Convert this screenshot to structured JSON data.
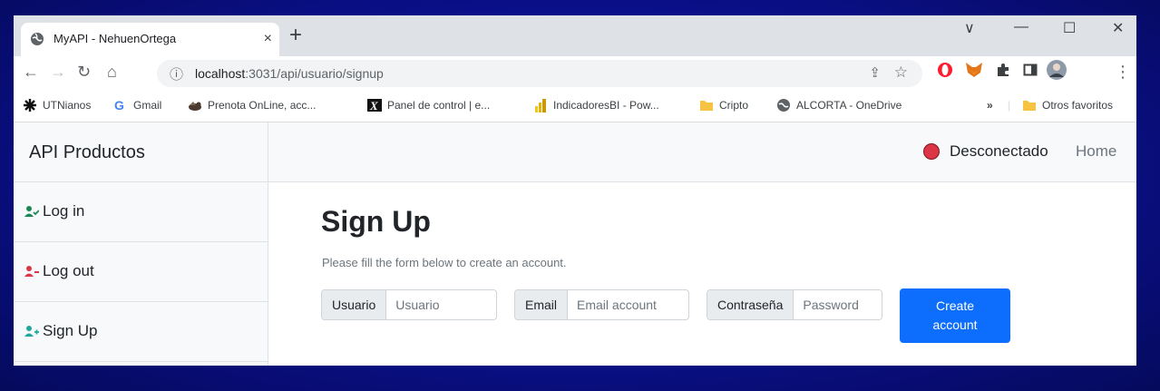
{
  "browser": {
    "tab_title": "MyAPI - NehuenOrtega",
    "tab_close": "×",
    "new_tab": "+",
    "window_controls": [
      "∨",
      "—",
      "☐",
      "✕"
    ],
    "url_host": "localhost",
    "url_rest": ":3031/api/usuario/signup",
    "bookmarks": [
      {
        "label": "UTNianos",
        "icon": "asterisk-icon"
      },
      {
        "label": "Gmail",
        "icon": "google-icon"
      },
      {
        "label": "Prenota OnLine, acc...",
        "icon": "bird-icon"
      },
      {
        "label": "Panel de control | e...",
        "icon": "x-logo-icon"
      },
      {
        "label": "IndicadoresBI - Pow...",
        "icon": "powerbi-icon"
      },
      {
        "label": "Cripto",
        "icon": "folder-icon"
      },
      {
        "label": "ALCORTA - OneDrive",
        "icon": "globe-icon"
      }
    ],
    "more_bookmarks": "»",
    "other_favorites": "Otros favoritos"
  },
  "sidebar": {
    "brand": "API Productos",
    "items": [
      {
        "label": "Log in",
        "color": "#198754"
      },
      {
        "label": "Log out",
        "color": "#dc3545"
      },
      {
        "label": "Sign Up",
        "color": "#20a8a0"
      }
    ]
  },
  "topnav": {
    "status": "Desconectado",
    "status_color": "#dc3545",
    "home": "Home"
  },
  "main": {
    "title": "Sign Up",
    "subtitle": "Please fill the form below to create an account.",
    "fields": [
      {
        "label": "Usuario",
        "placeholder": "Usuario"
      },
      {
        "label": "Email",
        "placeholder": "Email account"
      },
      {
        "label": "Contraseña",
        "placeholder": "Password"
      }
    ],
    "submit": "Create account"
  }
}
